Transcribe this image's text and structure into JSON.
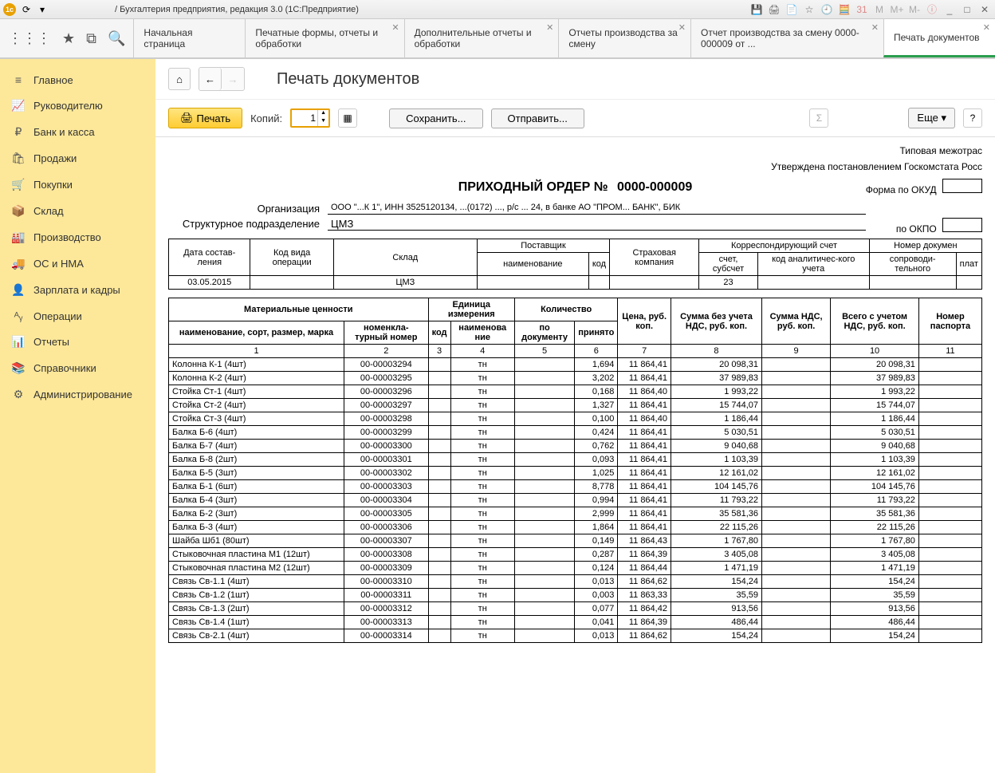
{
  "window_title": "/ Бухгалтерия предприятия, редакция 3.0  (1С:Предприятие)",
  "tabs": [
    {
      "label": "Начальная страница",
      "active": false
    },
    {
      "label": "Печатные формы, отчеты и обработки",
      "active": false
    },
    {
      "label": "Дополнительные отчеты и обработки",
      "active": false
    },
    {
      "label": "Отчеты производства за смену",
      "active": false
    },
    {
      "label": "Отчет производства за смену 0000-000009 от ...",
      "active": false
    },
    {
      "label": "Печать документов",
      "active": true
    }
  ],
  "sidebar": [
    {
      "icon": "≡",
      "label": "Главное"
    },
    {
      "icon": "📈",
      "label": "Руководителю"
    },
    {
      "icon": "₽",
      "label": "Банк и касса"
    },
    {
      "icon": "🛍",
      "label": "Продажи"
    },
    {
      "icon": "🛒",
      "label": "Покупки"
    },
    {
      "icon": "📦",
      "label": "Склад"
    },
    {
      "icon": "🏭",
      "label": "Производство"
    },
    {
      "icon": "🚚",
      "label": "ОС и НМА"
    },
    {
      "icon": "👤",
      "label": "Зарплата и кадры"
    },
    {
      "icon": "ᴬᵧ",
      "label": "Операции"
    },
    {
      "icon": "📊",
      "label": "Отчеты"
    },
    {
      "icon": "📚",
      "label": "Справочники"
    },
    {
      "icon": "⚙",
      "label": "Администрирование"
    }
  ],
  "page_title": "Печать документов",
  "toolbar": {
    "print": "Печать",
    "copies_label": "Копий:",
    "copies_value": "1",
    "save": "Сохранить...",
    "send": "Отправить...",
    "more": "Еще"
  },
  "doc": {
    "meta1": "Типовая межотрас",
    "meta2": "Утверждена постановлением Госкомстата Росс",
    "title_prefix": "ПРИХОДНЫЙ ОРДЕР №",
    "number": "0000-000009",
    "org_label": "Организация",
    "org_redacted": "ООО \"...К 1\", ИНН 3525120134, ...(0172) ..., р/с ...  24, в банке АО \"ПРОМ... БАНК\", БИК",
    "dept_label": "Структурное подразделение",
    "dept_value": "ЦМЗ",
    "form_okud": "Форма по ОКУД",
    "form_okpo": "по ОКПО"
  },
  "header_table": {
    "h": {
      "date": "Дата состав-ления",
      "op": "Код вида операции",
      "sklad": "Склад",
      "supplier": "Поставщик",
      "supplier_name": "наименование",
      "supplier_code": "код",
      "ins": "Страховая компания",
      "corr": "Корреспондирующий счет",
      "acc": "счет, субсчет",
      "anal": "код аналитичес-кого учета",
      "docnum": "Номер докумен",
      "accomp": "сопроводи-тельного",
      "pay": "плат"
    },
    "row": {
      "date": "03.05.2015",
      "sklad": "ЦМЗ",
      "acc": "23"
    }
  },
  "data_headers": {
    "mat": "Материальные ценности",
    "name": "наименование, сорт, размер, марка",
    "nom": "номенкла-турный номер",
    "unit": "Единица измерения",
    "code": "код",
    "uname": "наименова ние",
    "qty": "Количество",
    "bydoc": "по документу",
    "acc": "принято",
    "price": "Цена, руб. коп.",
    "sum_novat": "Сумма без учета НДС, руб. коп.",
    "vat": "Сумма НДС, руб. коп.",
    "total": "Всего с учетом НДС, руб. коп.",
    "passport": "Номер паспорта"
  },
  "rows": [
    {
      "name": "Колонна К-1 (4шт)",
      "nom": "00-00003294",
      "un": "тн",
      "qty": "1,694",
      "price": "11 864,41",
      "sum": "20 098,31",
      "tot": "20 098,31"
    },
    {
      "name": "Колонна К-2 (4шт)",
      "nom": "00-00003295",
      "un": "тн",
      "qty": "3,202",
      "price": "11 864,41",
      "sum": "37 989,83",
      "tot": "37 989,83"
    },
    {
      "name": "Стойка Ст-1 (4шт)",
      "nom": "00-00003296",
      "un": "тн",
      "qty": "0,168",
      "price": "11 864,40",
      "sum": "1 993,22",
      "tot": "1 993,22"
    },
    {
      "name": "Стойка Ст-2 (4шт)",
      "nom": "00-00003297",
      "un": "тн",
      "qty": "1,327",
      "price": "11 864,41",
      "sum": "15 744,07",
      "tot": "15 744,07"
    },
    {
      "name": "Стойка Ст-3 (4шт)",
      "nom": "00-00003298",
      "un": "тн",
      "qty": "0,100",
      "price": "11 864,40",
      "sum": "1 186,44",
      "tot": "1 186,44"
    },
    {
      "name": "Балка Б-6 (4шт)",
      "nom": "00-00003299",
      "un": "тн",
      "qty": "0,424",
      "price": "11 864,41",
      "sum": "5 030,51",
      "tot": "5 030,51"
    },
    {
      "name": "Балка Б-7 (4шт)",
      "nom": "00-00003300",
      "un": "тн",
      "qty": "0,762",
      "price": "11 864,41",
      "sum": "9 040,68",
      "tot": "9 040,68"
    },
    {
      "name": "Балка Б-8 (2шт)",
      "nom": "00-00003301",
      "un": "тн",
      "qty": "0,093",
      "price": "11 864,41",
      "sum": "1 103,39",
      "tot": "1 103,39"
    },
    {
      "name": "Балка Б-5 (3шт)",
      "nom": "00-00003302",
      "un": "тн",
      "qty": "1,025",
      "price": "11 864,41",
      "sum": "12 161,02",
      "tot": "12 161,02"
    },
    {
      "name": "Балка Б-1 (6шт)",
      "nom": "00-00003303",
      "un": "тн",
      "qty": "8,778",
      "price": "11 864,41",
      "sum": "104 145,76",
      "tot": "104 145,76"
    },
    {
      "name": "Балка Б-4 (3шт)",
      "nom": "00-00003304",
      "un": "тн",
      "qty": "0,994",
      "price": "11 864,41",
      "sum": "11 793,22",
      "tot": "11 793,22"
    },
    {
      "name": "Балка Б-2 (3шт)",
      "nom": "00-00003305",
      "un": "тн",
      "qty": "2,999",
      "price": "11 864,41",
      "sum": "35 581,36",
      "tot": "35 581,36"
    },
    {
      "name": "Балка Б-3 (4шт)",
      "nom": "00-00003306",
      "un": "тн",
      "qty": "1,864",
      "price": "11 864,41",
      "sum": "22 115,26",
      "tot": "22 115,26"
    },
    {
      "name": "Шайба Шб1 (80шт)",
      "nom": "00-00003307",
      "un": "тн",
      "qty": "0,149",
      "price": "11 864,43",
      "sum": "1 767,80",
      "tot": "1 767,80"
    },
    {
      "name": "Стыковочная пластина М1 (12шт)",
      "nom": "00-00003308",
      "un": "тн",
      "qty": "0,287",
      "price": "11 864,39",
      "sum": "3 405,08",
      "tot": "3 405,08"
    },
    {
      "name": "Стыковочная пластина М2 (12шт)",
      "nom": "00-00003309",
      "un": "тн",
      "qty": "0,124",
      "price": "11 864,44",
      "sum": "1 471,19",
      "tot": "1 471,19"
    },
    {
      "name": "Связь Св-1.1 (4шт)",
      "nom": "00-00003310",
      "un": "тн",
      "qty": "0,013",
      "price": "11 864,62",
      "sum": "154,24",
      "tot": "154,24"
    },
    {
      "name": "Связь Св-1.2 (1шт)",
      "nom": "00-00003311",
      "un": "тн",
      "qty": "0,003",
      "price": "11 863,33",
      "sum": "35,59",
      "tot": "35,59"
    },
    {
      "name": "Связь Св-1.3 (2шт)",
      "nom": "00-00003312",
      "un": "тн",
      "qty": "0,077",
      "price": "11 864,42",
      "sum": "913,56",
      "tot": "913,56"
    },
    {
      "name": "Связь Св-1.4 (1шт)",
      "nom": "00-00003313",
      "un": "тн",
      "qty": "0,041",
      "price": "11 864,39",
      "sum": "486,44",
      "tot": "486,44"
    },
    {
      "name": "Связь Св-2.1 (4шт)",
      "nom": "00-00003314",
      "un": "тн",
      "qty": "0,013",
      "price": "11 864,62",
      "sum": "154,24",
      "tot": "154,24"
    }
  ]
}
